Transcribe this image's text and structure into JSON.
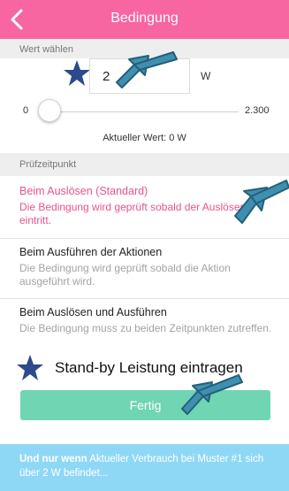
{
  "header": {
    "title": "Bedingung",
    "back_icon": "chevron-left-icon"
  },
  "value_section": {
    "heading": "Wert wählen",
    "input_value": "2",
    "unit": "W",
    "slider": {
      "min_label": "0",
      "max_label": "2.300",
      "min": 0,
      "max": 2300,
      "value": 0
    },
    "current_value_label": "Aktueller Wert: 0 W"
  },
  "check_section": {
    "heading": "Prüfzeitpunkt",
    "options": [
      {
        "title": "Beim Auslösen (Standard)",
        "description": "Die Bedingung wird geprüft sobald der Auslöser eintritt.",
        "selected": true
      },
      {
        "title": "Beim Ausführen der Aktionen",
        "description": "Die Bedingung wird geprüft sobald die Aktion ausgeführt wird.",
        "selected": false
      },
      {
        "title": "Beim Auslösen und Ausführen",
        "description": "Die Bedingung muss zu beiden Zeitpunkten zutreffen.",
        "selected": false
      }
    ]
  },
  "annotation": {
    "hint_text": "Stand-by Leistung eintragen",
    "star_icon": "star-icon",
    "arrow_icon": "arrow-icon"
  },
  "done_button": {
    "label": "Fertig"
  },
  "footer": {
    "bold": "Und nur wenn",
    "text": " Aktueller Verbrauch bei Muster #1 sich über 2 W befindet..."
  },
  "colors": {
    "header": "#f766a0",
    "selected_option": "#e8538f",
    "button": "#6fd5b3",
    "footer": "#8fd8f5",
    "annotation": "#2c4a8c"
  }
}
